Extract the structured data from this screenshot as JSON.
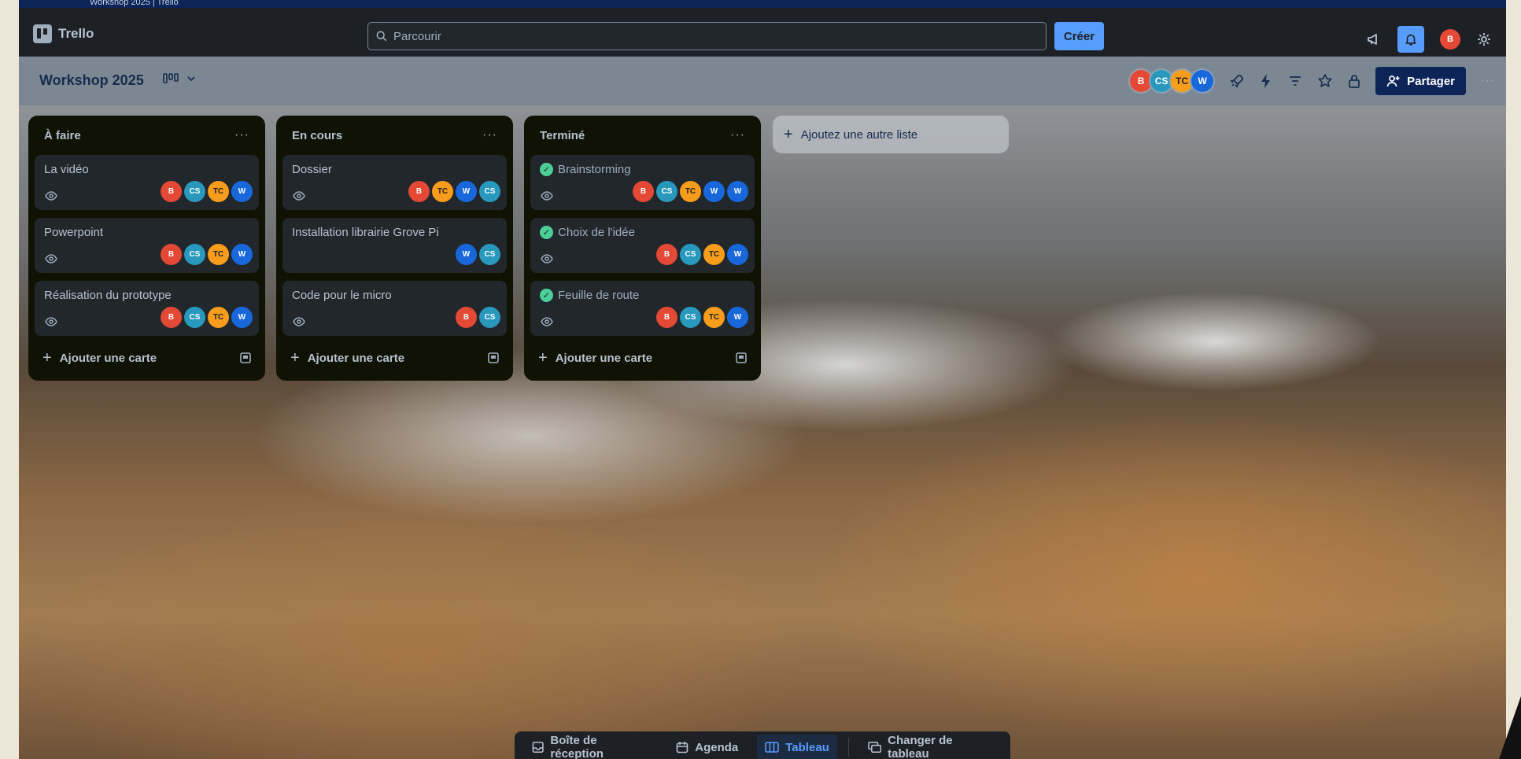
{
  "window": {
    "title": "Workshop 2025 | Trello"
  },
  "topbar": {
    "app_name": "Trello",
    "search_placeholder": "Parcourir",
    "create_label": "Créer",
    "user_initial": "B"
  },
  "board": {
    "title": "Workshop 2025",
    "members": [
      {
        "initials": "B",
        "color": "#e34935"
      },
      {
        "initials": "CS",
        "color": "#2898bd"
      },
      {
        "initials": "TC",
        "color": "#f89c1c"
      },
      {
        "initials": "W",
        "color": "#1868db"
      }
    ],
    "share_label": "Partager"
  },
  "lists": [
    {
      "title": "À faire",
      "cards": [
        {
          "title": "La vidéo",
          "done": false,
          "watch": true,
          "members": [
            "B",
            "CS",
            "TC",
            "W"
          ]
        },
        {
          "title": "Powerpoint",
          "done": false,
          "watch": true,
          "members": [
            "B",
            "CS",
            "TC",
            "W"
          ]
        },
        {
          "title": "Réalisation du prototype",
          "done": false,
          "watch": true,
          "members": [
            "B",
            "CS",
            "TC",
            "W"
          ]
        }
      ],
      "add_card_label": "Ajouter une carte"
    },
    {
      "title": "En cours",
      "cards": [
        {
          "title": "Dossier",
          "done": false,
          "watch": true,
          "members": [
            "B",
            "TC",
            "W",
            "CS"
          ]
        },
        {
          "title": "Installation librairie Grove Pi",
          "done": false,
          "watch": false,
          "members": [
            "W",
            "CS"
          ]
        },
        {
          "title": "Code pour le micro",
          "done": false,
          "watch": true,
          "members": [
            "B",
            "CS"
          ]
        }
      ],
      "add_card_label": "Ajouter une carte"
    },
    {
      "title": "Terminé",
      "cards": [
        {
          "title": "Brainstorming",
          "done": true,
          "watch": true,
          "members": [
            "B",
            "CS",
            "TC",
            "W",
            "W"
          ]
        },
        {
          "title": "Choix de l'idée",
          "done": true,
          "watch": true,
          "members": [
            "B",
            "CS",
            "TC",
            "W"
          ]
        },
        {
          "title": "Feuille de route",
          "done": true,
          "watch": true,
          "members": [
            "B",
            "CS",
            "TC",
            "W"
          ]
        }
      ],
      "add_card_label": "Ajouter une carte"
    }
  ],
  "add_list_label": "Ajoutez une autre liste",
  "bottom_nav": [
    {
      "label": "Boîte de réception",
      "icon": "inbox-icon",
      "active": false
    },
    {
      "label": "Agenda",
      "icon": "calendar-icon",
      "active": false
    },
    {
      "label": "Tableau",
      "icon": "board-icon",
      "active": true
    },
    {
      "label": "Changer de tableau",
      "icon": "switch-board-icon",
      "active": false
    }
  ],
  "colors": {
    "accent": "#579dff",
    "list_bg": "#101204",
    "card_bg": "#22272b",
    "done_check": "#4bce97"
  }
}
